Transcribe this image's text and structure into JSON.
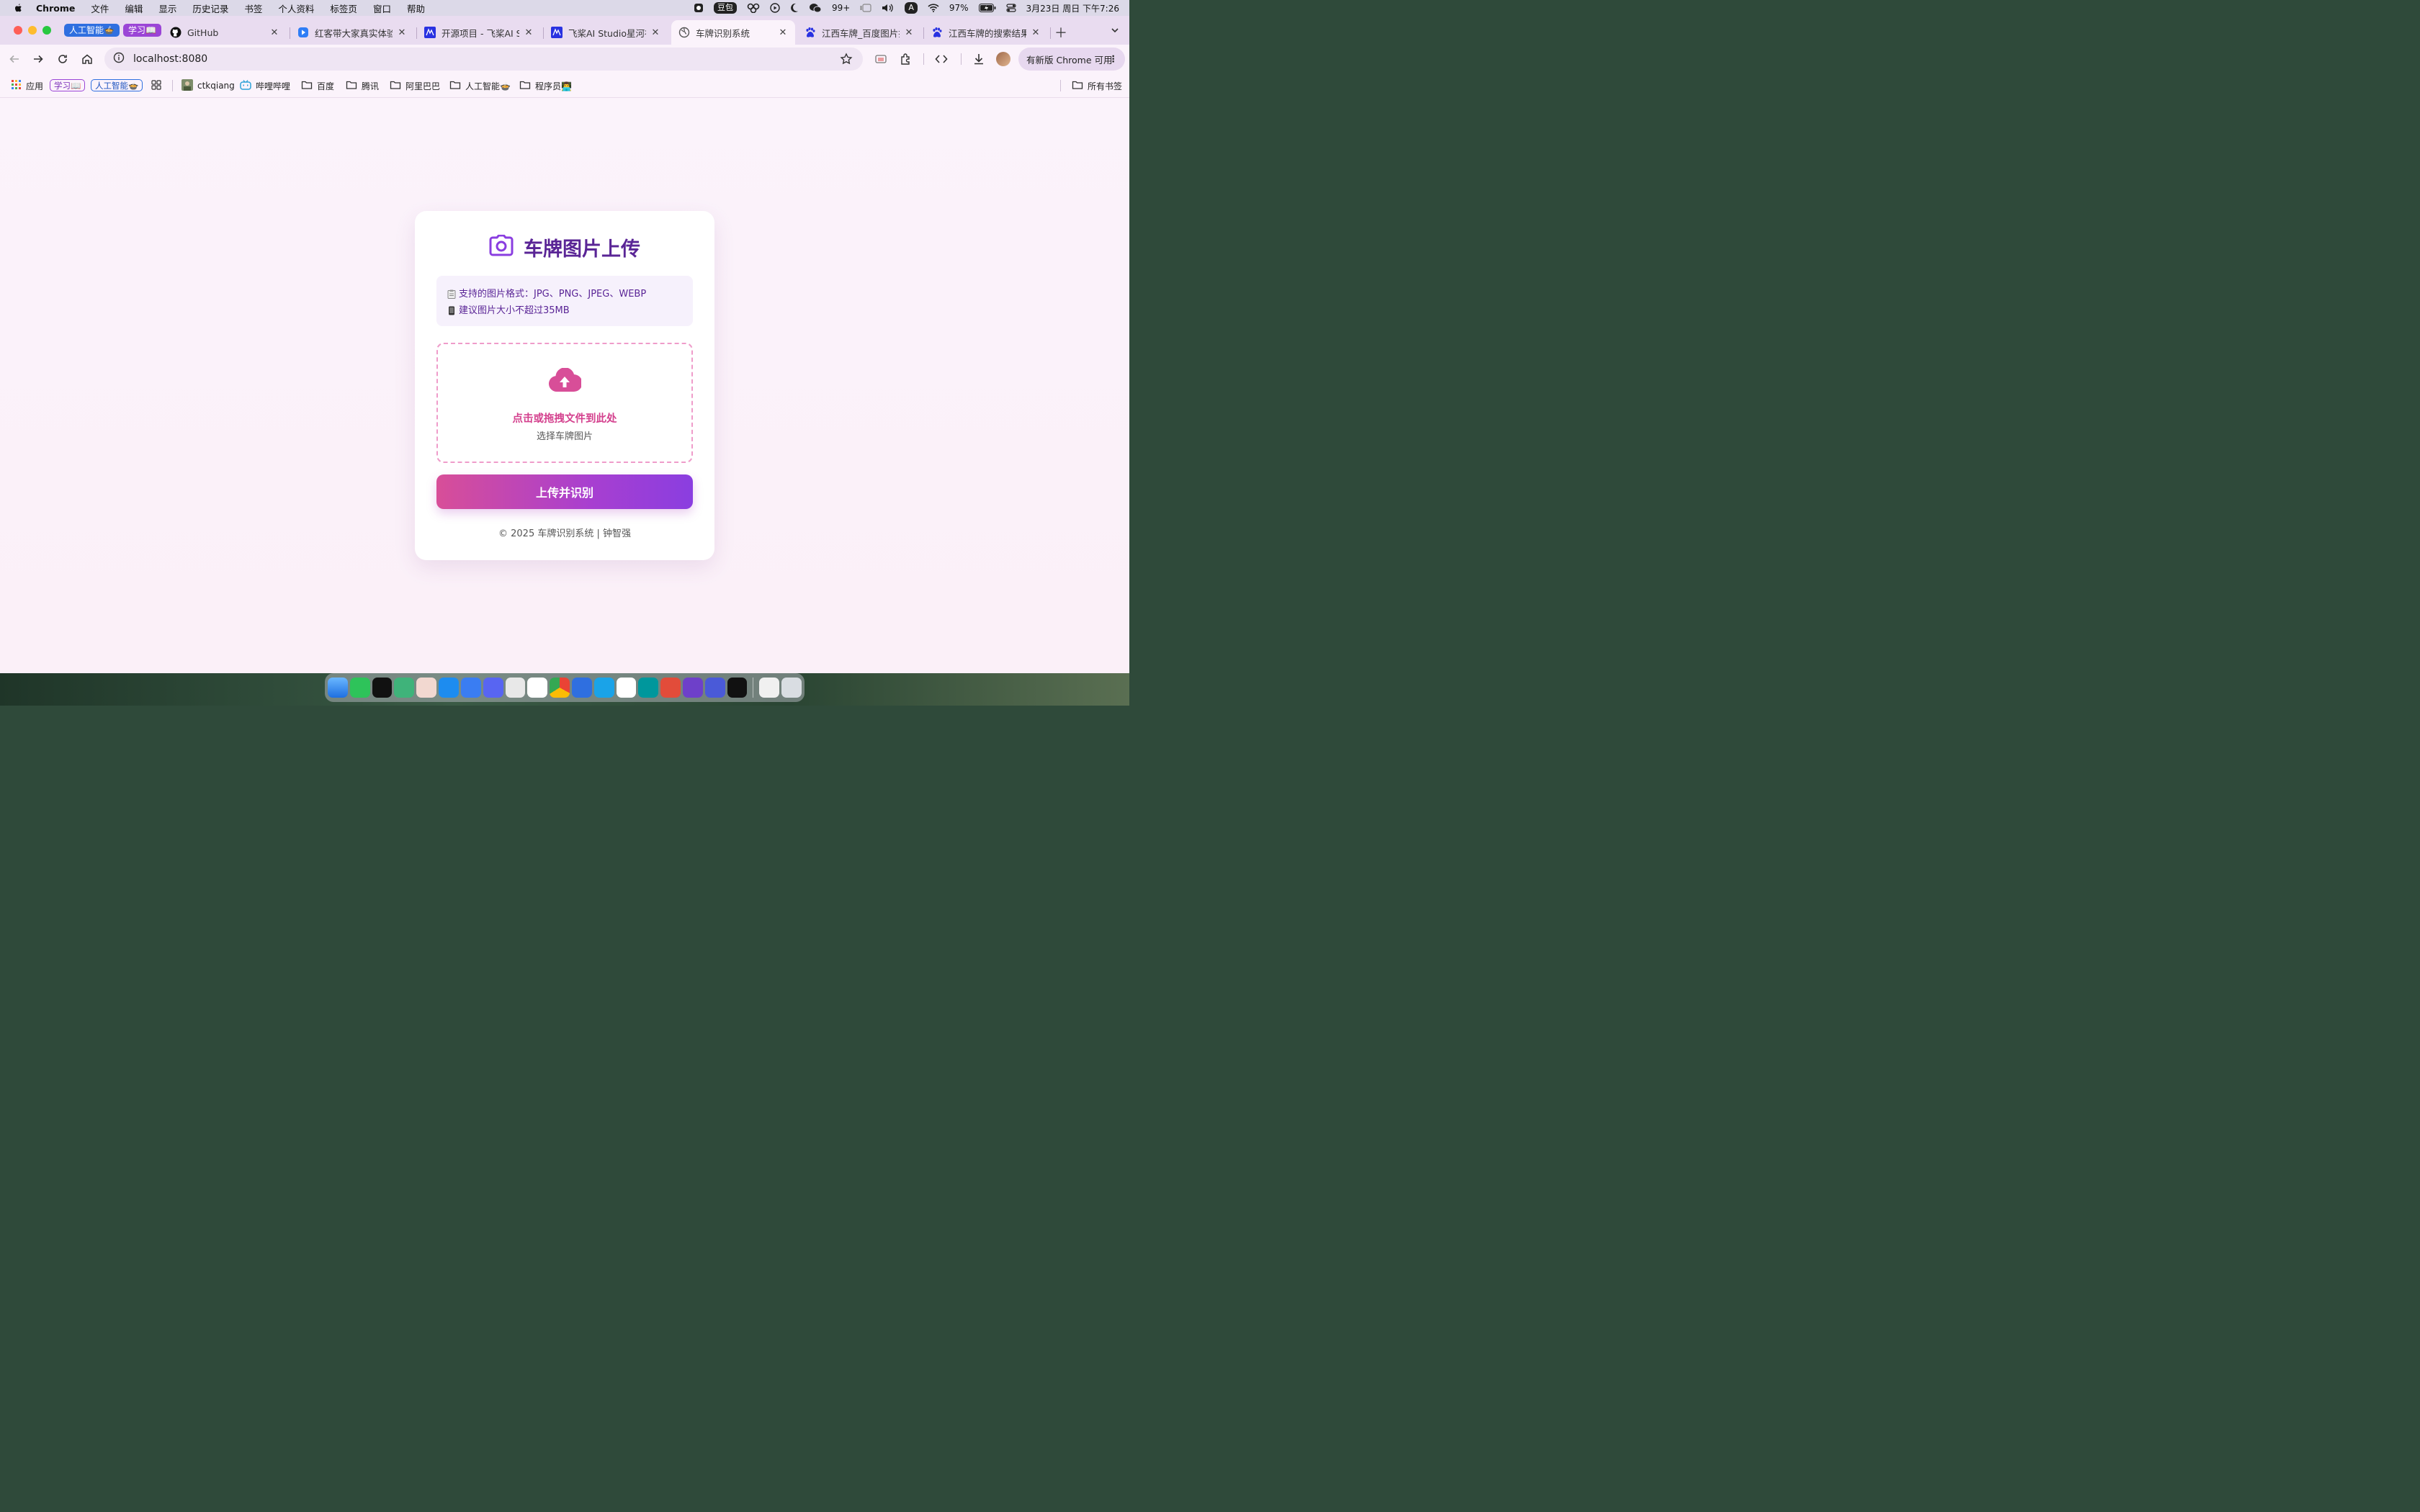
{
  "menubar": {
    "app": "Chrome",
    "items": [
      "文件",
      "编辑",
      "显示",
      "历史记录",
      "书签",
      "个人资料",
      "标签页",
      "窗口",
      "帮助"
    ],
    "doubao": "豆包",
    "wechat_count": "99+",
    "input_source": "A",
    "battery": "97%",
    "datetime": "3月23日 周日  下午7:26"
  },
  "tab_groups": [
    {
      "label": "人工智能🍲",
      "color": "#2f6fe0"
    },
    {
      "label": "学习📖",
      "color": "#9b45d6"
    }
  ],
  "tabs": [
    {
      "title": "GitHub",
      "icon": "github-icon"
    },
    {
      "title": "红客带大家真实体验洪",
      "icon": "video-icon"
    },
    {
      "title": "开源项目 - 飞桨AI Stu",
      "icon": "paddle-icon"
    },
    {
      "title": "飞桨AI Studio星河社区",
      "icon": "paddle-icon"
    },
    {
      "title": "车牌识别系统",
      "icon": "globe-icon",
      "active": true
    },
    {
      "title": "江西车牌_百度图片搜索",
      "icon": "baidu-icon"
    },
    {
      "title": "江西车牌的搜索结果_百",
      "icon": "baidu-icon"
    }
  ],
  "toolbar": {
    "url": "localhost:8080",
    "update_label": "有新版 Chrome 可用"
  },
  "bookmarks": {
    "apps": "应用",
    "chip_study": "学习📖",
    "chip_ai": "人工智能🍲",
    "items": [
      "ctkqiang",
      "哔哩哔哩",
      "百度",
      "腾讯",
      "阿里巴巴",
      "人工智能🍲",
      "程序员👨‍💻"
    ],
    "all": "所有书签"
  },
  "upload_card": {
    "title": "车牌图片上传",
    "formats": "支持的图片格式：JPG、PNG、JPEG、WEBP",
    "size_hint": "建议图片大小不超过35MB",
    "drop_main": "点击或拖拽文件到此处",
    "drop_sub": "选择车牌图片",
    "button": "上传并识别",
    "footer": "© 2025 车牌识别系统 | 钟智强"
  },
  "colors": {
    "accent": "#5a2596",
    "pink": "#d4418e",
    "button_start": "#d84e98",
    "button_end": "#8a3ee0"
  }
}
